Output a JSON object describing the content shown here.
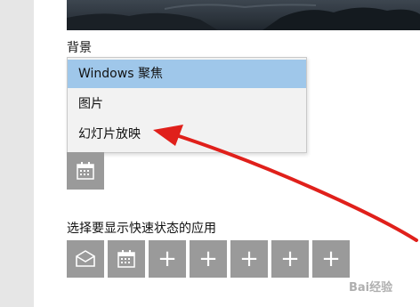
{
  "background": {
    "label": "背景",
    "options": [
      "Windows 聚焦",
      "图片",
      "幻灯片放映"
    ],
    "selected_index": 0,
    "selected_color": "#9fc7ea"
  },
  "quick_status": {
    "label": "选择要显示快速状态的应用",
    "tiles": [
      "mail-icon",
      "calendar-icon",
      "+",
      "+",
      "+",
      "+",
      "+"
    ]
  },
  "annotation": {
    "arrow_color": "#e0201b",
    "points_to": "幻灯片放映"
  },
  "watermark": "Bai经验"
}
